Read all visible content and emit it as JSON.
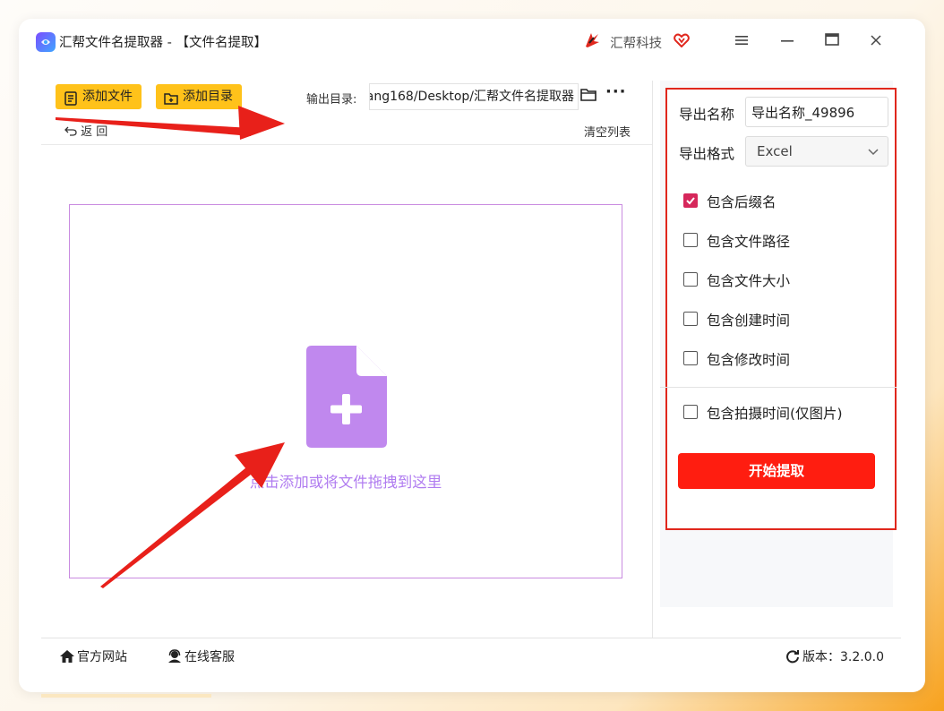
{
  "app": {
    "title": "汇帮文件名提取器 - 【文件名提取】",
    "brand": "汇帮科技"
  },
  "toolbar": {
    "add_file": "添加文件",
    "add_folder": "添加目录",
    "output_label": "输出目录:",
    "output_path": "ang168/Desktop/汇帮文件名提取器",
    "more": "···",
    "back": "返  回",
    "clear_list": "清空列表"
  },
  "drop_zone": {
    "text": "点击添加或将文件拖拽到这里"
  },
  "settings": {
    "export_name_label": "导出名称",
    "export_name_value": "导出名称_49896",
    "export_format_label": "导出格式",
    "export_format_value": "Excel",
    "options": [
      {
        "label": "包含后缀名",
        "checked": true
      },
      {
        "label": "包含文件路径",
        "checked": false
      },
      {
        "label": "包含文件大小",
        "checked": false
      },
      {
        "label": "包含创建时间",
        "checked": false
      },
      {
        "label": "包含修改时间",
        "checked": false
      },
      {
        "label": "包含拍摄时间(仅图片)",
        "checked": false
      }
    ],
    "start_button": "开始提取"
  },
  "status_bar": {
    "website": "官方网站",
    "support": "在线客服",
    "version": "版本：3.2.0.0"
  },
  "colors": {
    "accent_yellow": "#ffc21a",
    "start_red": "#ff1d10",
    "checkbox_pink": "#d6275b",
    "drop_purple": "#b07cf0",
    "highlight_red": "#e0271d"
  }
}
